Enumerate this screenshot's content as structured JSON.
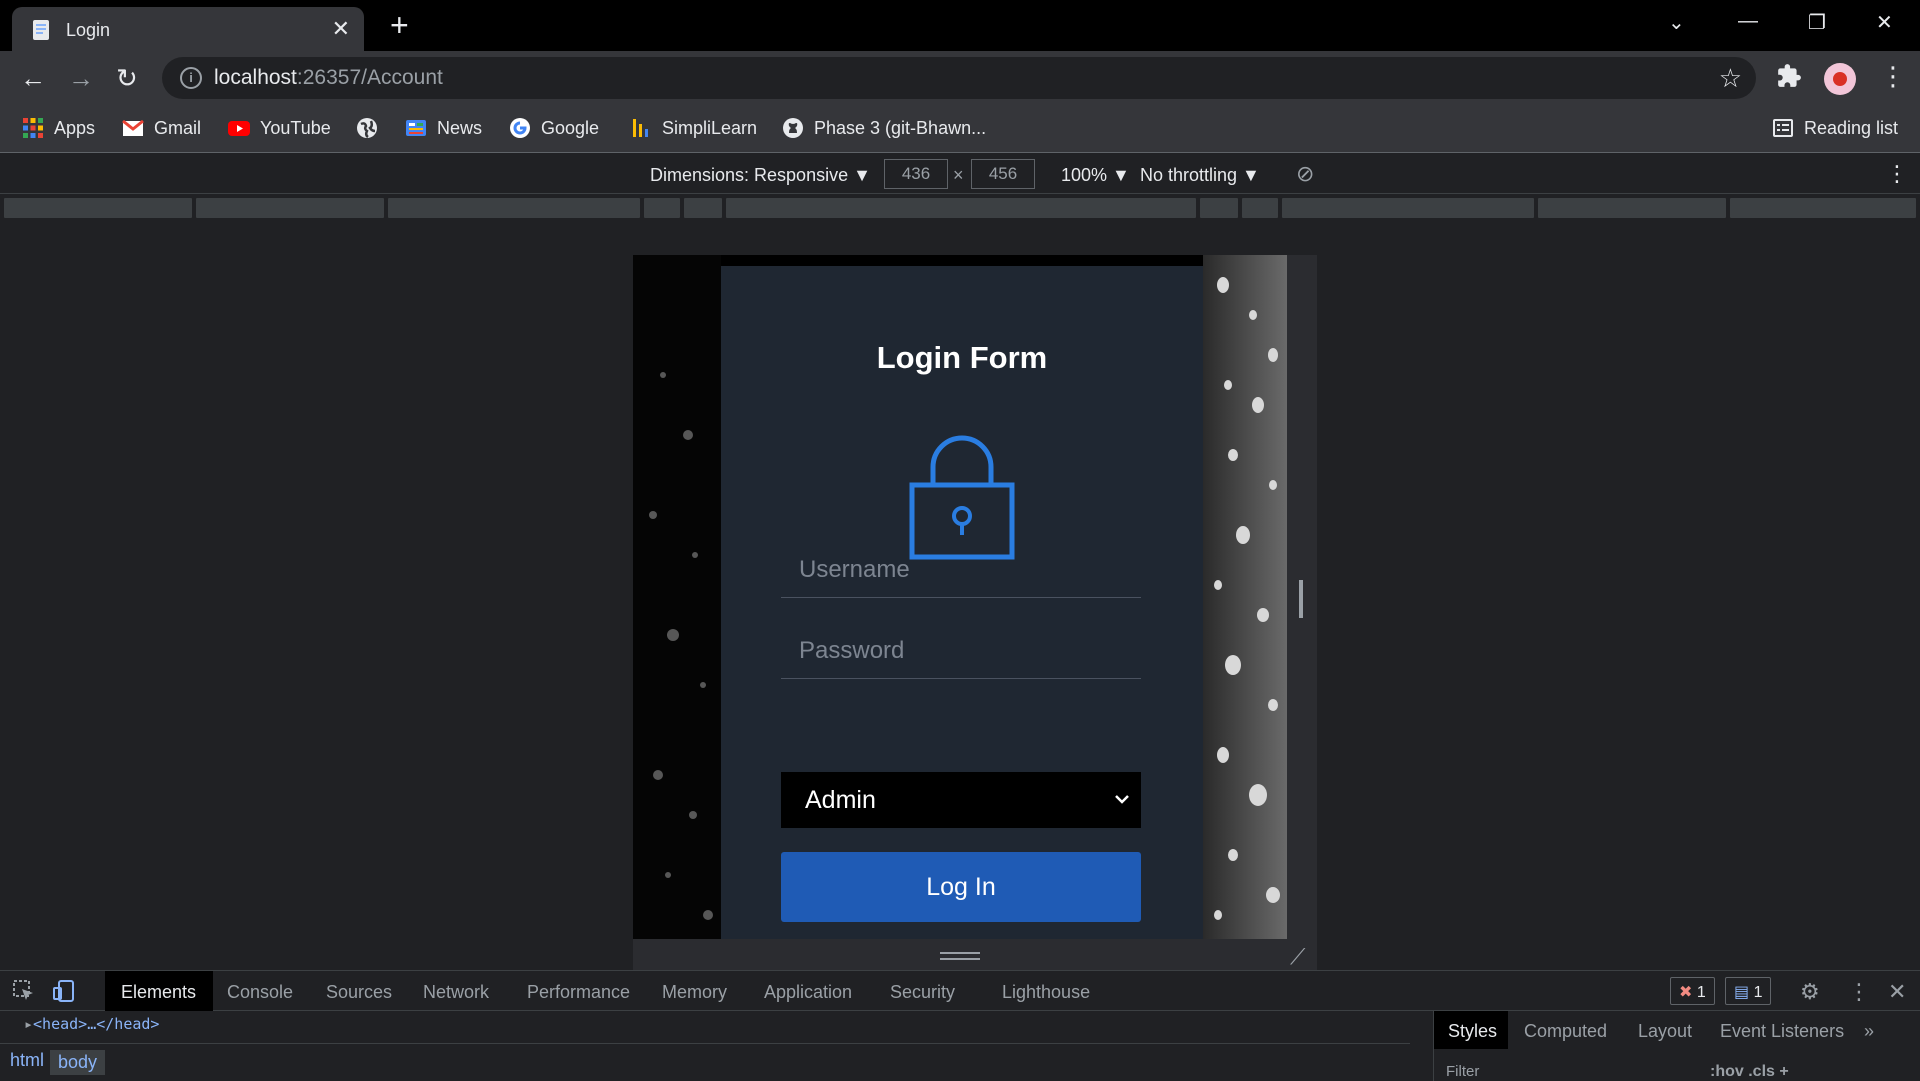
{
  "browser": {
    "tab_title": "Login",
    "tab_close": "✕",
    "new_tab": "+",
    "url_host": "localhost",
    "url_rest": ":26357/Account",
    "bookmarks": [
      {
        "label": "Apps",
        "icon": "apps-grid-icon"
      },
      {
        "label": "Gmail",
        "icon": "gmail-icon"
      },
      {
        "label": "YouTube",
        "icon": "youtube-icon"
      },
      {
        "label": "",
        "icon": "globe-icon"
      },
      {
        "label": "News",
        "icon": "news-icon"
      },
      {
        "label": "Google",
        "icon": "google-icon"
      },
      {
        "label": "SimpliLearn",
        "icon": "simplilearn-icon"
      },
      {
        "label": "Phase 3 (git-Bhawn...",
        "icon": "github-icon"
      }
    ],
    "reading_list": "Reading list"
  },
  "device_toolbar": {
    "dimensions_label": "Dimensions: Responsive ▼",
    "width": "436",
    "times": "×",
    "height": "456",
    "zoom": "100% ▼",
    "throttling": "No throttling ▼"
  },
  "login": {
    "title": "Login Form",
    "username_placeholder": "Username",
    "password_placeholder": "Password",
    "role_selected": "Admin",
    "login_button": "Log In",
    "accent_color": "#1f5bb5",
    "lock_color": "#2a7de1"
  },
  "devtools": {
    "tabs": [
      "Elements",
      "Console",
      "Sources",
      "Network",
      "Performance",
      "Memory",
      "Application",
      "Security",
      "Lighthouse"
    ],
    "errors_count": "1",
    "messages_count": "1",
    "dom_line": "<head>…</head>",
    "breadcrumbs": [
      "html",
      "body"
    ],
    "styles_tabs": [
      "Styles",
      "Computed",
      "Layout",
      "Event Listeners"
    ],
    "filter_placeholder": "Filter",
    "styles_tools": ":hov  .cls  +"
  }
}
